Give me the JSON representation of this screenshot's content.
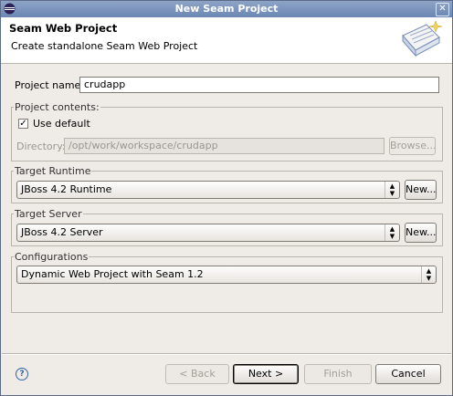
{
  "window": {
    "title": "New Seam Project"
  },
  "banner": {
    "title": "Seam Web Project",
    "description": "Create standalone Seam Web Project"
  },
  "project_name": {
    "label": "Project name:",
    "value": "crudapp"
  },
  "project_contents": {
    "group_label": "Project contents:",
    "use_default_label": "Use default",
    "use_default_checked": true,
    "directory_label": "Directory:",
    "directory_value": "/opt/work/workspace/crudapp",
    "browse_label": "Browse..."
  },
  "target_runtime": {
    "group_label": "Target Runtime",
    "selected": "JBoss 4.2 Runtime",
    "new_label": "New..."
  },
  "target_server": {
    "group_label": "Target Server",
    "selected": "JBoss 4.2 Server",
    "new_label": "New..."
  },
  "configurations": {
    "group_label": "Configurations",
    "selected": "Dynamic Web Project with Seam 1.2"
  },
  "footer": {
    "help_glyph": "?",
    "back_label": "< Back",
    "next_label": "Next >",
    "finish_label": "Finish",
    "cancel_label": "Cancel"
  },
  "icons": {
    "app": "eclipse-icon",
    "close": "close-icon",
    "wizard": "seam-wizard-icon",
    "help": "help-icon"
  }
}
